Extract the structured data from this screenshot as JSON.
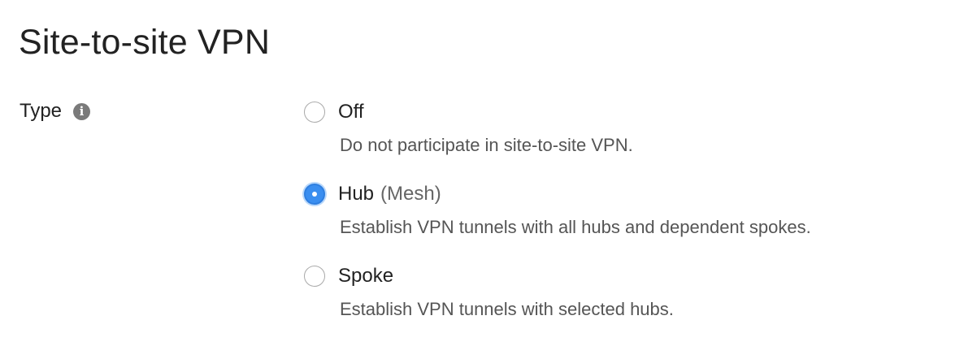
{
  "page": {
    "title": "Site-to-site VPN"
  },
  "type_field": {
    "label": "Type",
    "info_icon": "info-icon",
    "selected": "hub",
    "options": [
      {
        "id": "off",
        "label": "Off",
        "sublabel": "",
        "description": "Do not participate in site-to-site VPN.",
        "selected": false
      },
      {
        "id": "hub",
        "label": "Hub",
        "sublabel": "(Mesh)",
        "description": "Establish VPN tunnels with all hubs and dependent spokes.",
        "selected": true
      },
      {
        "id": "spoke",
        "label": "Spoke",
        "sublabel": "",
        "description": "Establish VPN tunnels with selected hubs.",
        "selected": false
      }
    ]
  },
  "colors": {
    "radio_selected": "#3a8ef0",
    "radio_border": "#a9a9a9",
    "text_primary": "#222222",
    "text_secondary": "#555555"
  }
}
